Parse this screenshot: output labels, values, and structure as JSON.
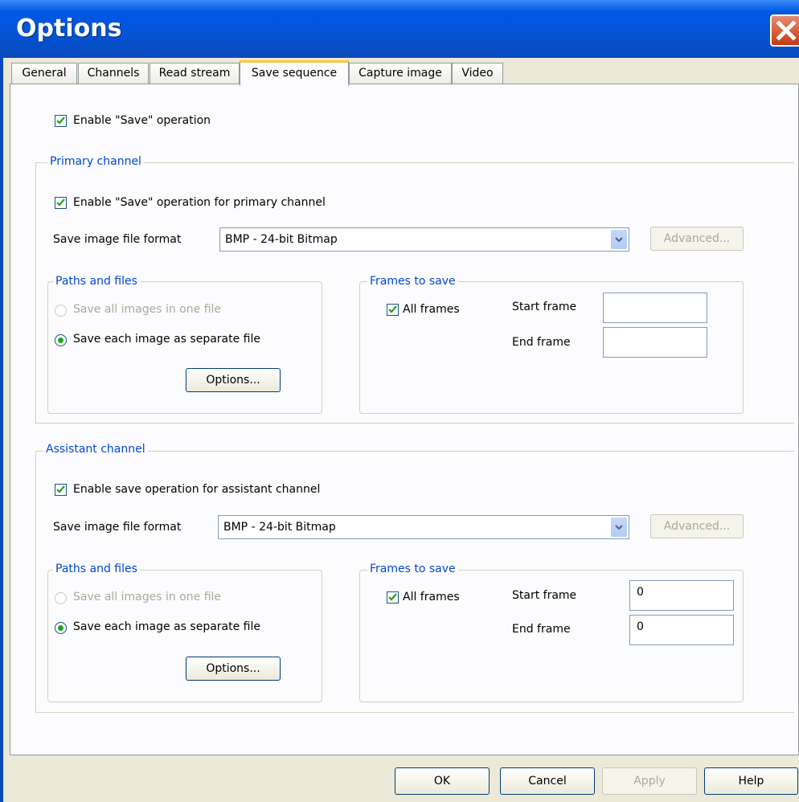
{
  "window": {
    "title": "Options"
  },
  "tabs": [
    "General",
    "Channels",
    "Read stream",
    "Save sequence",
    "Capture image",
    "Video"
  ],
  "enable_save_label": "Enable \"Save\" operation",
  "primary": {
    "group_title": "Primary channel",
    "enable_label": "Enable \"Save\" operation for primary channel",
    "format_label": "Save image file format",
    "format_value": "BMP - 24-bit Bitmap",
    "advanced_label": "Advanced...",
    "paths": {
      "title": "Paths and files",
      "one_file": "Save all  images in one file",
      "separate": "Save each image as separate file",
      "options_label": "Options..."
    },
    "frames": {
      "title": "Frames to save",
      "all_frames": "All frames",
      "start_label": "Start frame",
      "end_label": "End frame",
      "start_value": "",
      "end_value": ""
    }
  },
  "assistant": {
    "group_title": "Assistant channel",
    "enable_label": "Enable save operation for assistant channel",
    "format_label": "Save image file format",
    "format_value": "BMP - 24-bit Bitmap",
    "advanced_label": "Advanced...",
    "paths": {
      "title": "Paths and files",
      "one_file": "Save all  images in one file",
      "separate": "Save each image as separate file",
      "options_label": "Options..."
    },
    "frames": {
      "title": "Frames to save",
      "all_frames": "All frames",
      "start_label": "Start frame",
      "end_label": "End frame",
      "start_value": "0",
      "end_value": "0"
    }
  },
  "buttons": {
    "ok": "OK",
    "cancel": "Cancel",
    "apply": "Apply",
    "help": "Help"
  },
  "colors": {
    "title_bar": "#0553d6",
    "group_title": "#0046d5",
    "active_tab_accent": "#ffc83c",
    "check_mark": "#21a121"
  }
}
